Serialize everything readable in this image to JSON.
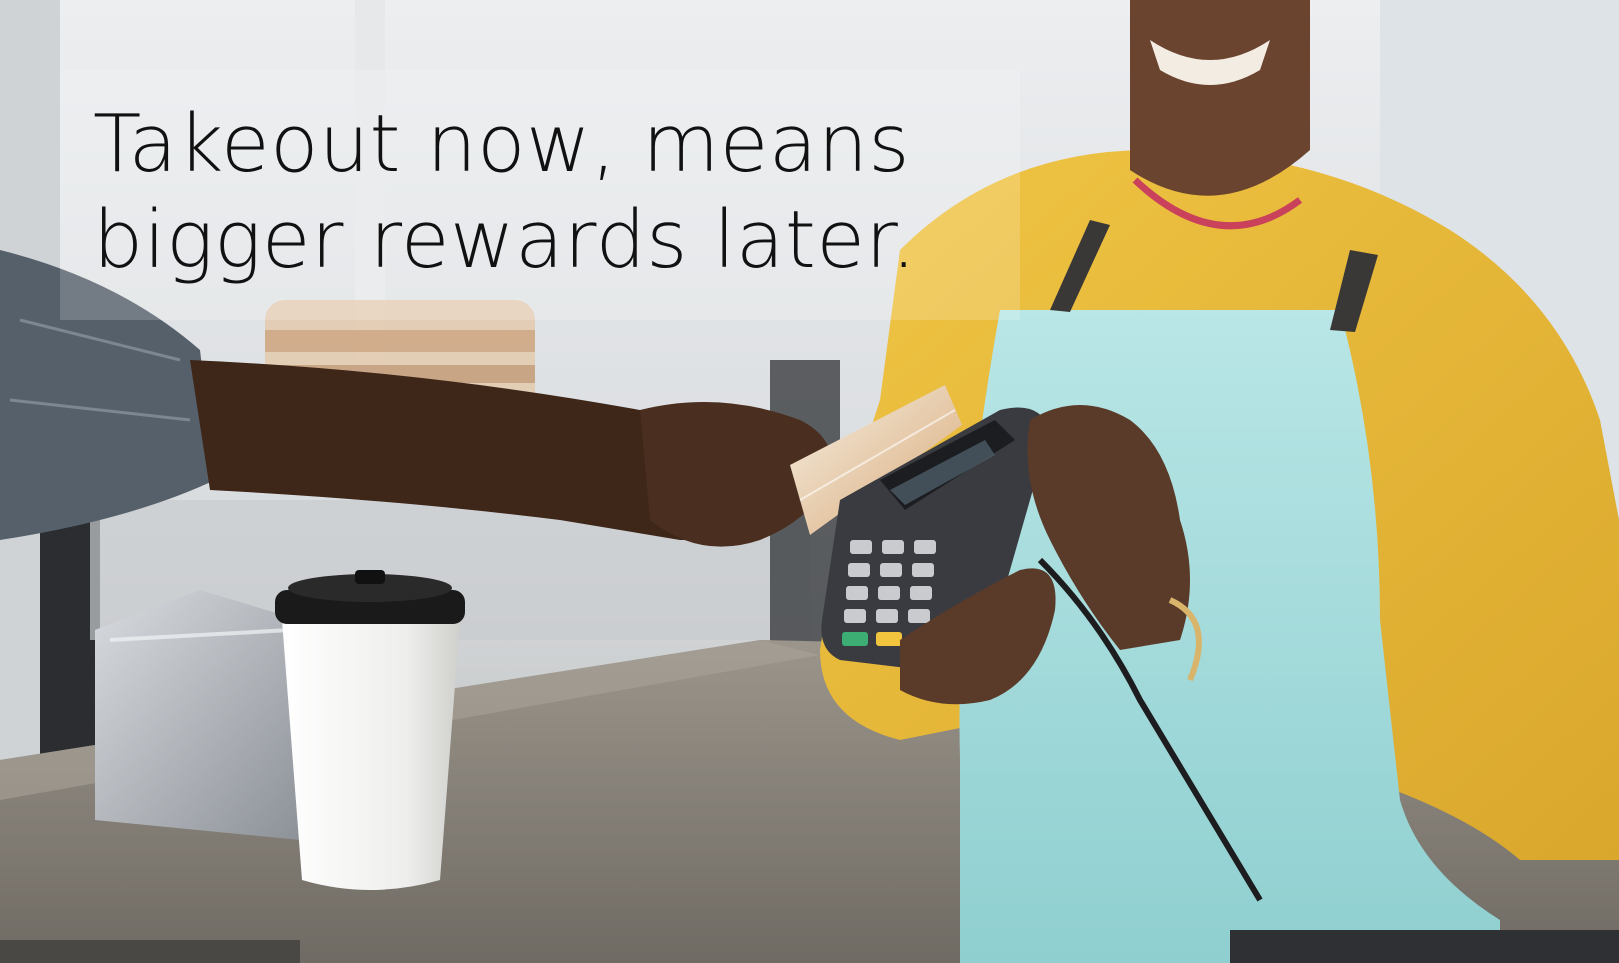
{
  "headline": {
    "line1": "Takeout now, means",
    "line2": "bigger rewards later."
  },
  "photo": {
    "subject": "card-payment-at-cafe-counter",
    "colors": {
      "apron": "#a9dcdc",
      "shirt": "#e8b737",
      "skin": "#5a3a28",
      "terminal": "#3a3b40",
      "counter": "#8a847a",
      "cup": "#f4f4f2",
      "lid": "#1a1a1a"
    }
  }
}
